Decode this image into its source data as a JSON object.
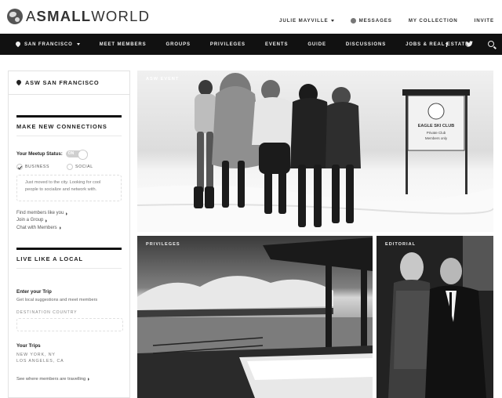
{
  "brand": {
    "name_light": "A",
    "name_bold": "SMALL",
    "name_rest": "WORLD"
  },
  "toplinks": {
    "user": "JULIE MAYVILLE",
    "messages": "MESSAGES",
    "collection": "MY COLLECTION",
    "invite": "INVITE"
  },
  "nav": {
    "city": "SAN FRANCISCO",
    "items": [
      "MEET MEMBERS",
      "GROUPS",
      "PRIVILEGES",
      "EVENTS",
      "GUIDE",
      "DISCUSSIONS",
      "JOBS & REAL ESTATE"
    ],
    "icons": [
      "facebook-icon",
      "twitter-icon",
      "search-icon"
    ]
  },
  "sidebar": {
    "heading": "ASW SAN FRANCISCO",
    "connect": {
      "title": "MAKE NEW CONNECTIONS",
      "status_label": "Your Meetup Status:",
      "toggle": "ON",
      "options": [
        "BUSINESS",
        "SOCIAL"
      ],
      "intro": "Just moved to the city. Looking for cool people to socialize and network with.",
      "links": [
        "Find members like you",
        "Join a Group",
        "Chat with Members"
      ]
    },
    "local": {
      "title": "LIVE LIKE A LOCAL",
      "trip_title": "Enter your Trip",
      "trip_sub": "Get local suggestions and meet members",
      "dest_label": "DESTINATION COUNTRY",
      "dest_placeholder": "",
      "your_trips": "Your Trips",
      "trips": [
        "NEW YORK, NY",
        "LOS ANGELES, CA"
      ],
      "travel_link": "See where members are travelling"
    }
  },
  "tiles": [
    {
      "label": "ASW EVENT",
      "sign": [
        "EAGLE SKI CLUB",
        "Private Club",
        "Members only"
      ]
    },
    {
      "label": "PRIVILEGES"
    },
    {
      "label": "EDITORIAL"
    }
  ]
}
